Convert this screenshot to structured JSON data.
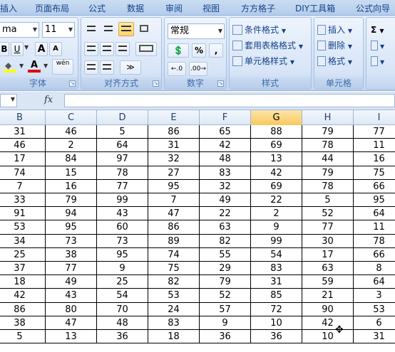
{
  "ribbon": {
    "tabs": [
      "插入",
      "页面布局",
      "公式",
      "数据",
      "审阅",
      "视图",
      "方方格子",
      "DIY工具箱",
      "公式向导"
    ],
    "font": {
      "name_value": "ma",
      "size_value": "11",
      "bold": "B",
      "underline": "U",
      "grow": "A",
      "shrink": "A",
      "phonetic": "wén",
      "label": "字体"
    },
    "alignment": {
      "label": "对齐方式"
    },
    "number": {
      "format_value": "常规",
      "percent": "%",
      "comma": ",",
      "label": "数字"
    },
    "styles": {
      "conditional": "条件格式",
      "table": "套用表格格式",
      "cell_styles": "单元格样式",
      "label": "样式"
    },
    "cells": {
      "insert": "插入",
      "delete": "删除",
      "format": "格式",
      "label": "单元格"
    },
    "editing": {
      "sum": "Σ"
    }
  },
  "formula_bar": {
    "fx": "fx"
  },
  "grid": {
    "columns": [
      "B",
      "C",
      "D",
      "E",
      "F",
      "G",
      "H",
      "I"
    ],
    "selected_column": "G",
    "rows": [
      [
        31,
        46,
        5,
        86,
        65,
        88,
        79,
        77
      ],
      [
        46,
        2,
        64,
        31,
        42,
        69,
        78,
        11
      ],
      [
        17,
        84,
        97,
        32,
        48,
        13,
        44,
        16
      ],
      [
        74,
        15,
        78,
        27,
        83,
        42,
        79,
        75
      ],
      [
        7,
        16,
        77,
        95,
        32,
        69,
        78,
        66
      ],
      [
        33,
        79,
        99,
        7,
        49,
        22,
        5,
        95
      ],
      [
        91,
        94,
        43,
        47,
        22,
        2,
        52,
        64
      ],
      [
        53,
        95,
        60,
        86,
        63,
        9,
        77,
        11
      ],
      [
        34,
        73,
        73,
        89,
        82,
        99,
        30,
        78
      ],
      [
        25,
        38,
        95,
        74,
        55,
        54,
        17,
        66
      ],
      [
        37,
        77,
        9,
        75,
        29,
        83,
        63,
        8
      ],
      [
        18,
        49,
        25,
        82,
        79,
        31,
        59,
        64
      ],
      [
        42,
        43,
        54,
        53,
        52,
        85,
        21,
        3
      ],
      [
        86,
        80,
        70,
        24,
        57,
        72,
        90,
        53
      ],
      [
        38,
        47,
        48,
        83,
        9,
        10,
        42,
        6
      ],
      [
        5,
        13,
        36,
        18,
        36,
        36,
        10,
        31
      ]
    ]
  }
}
